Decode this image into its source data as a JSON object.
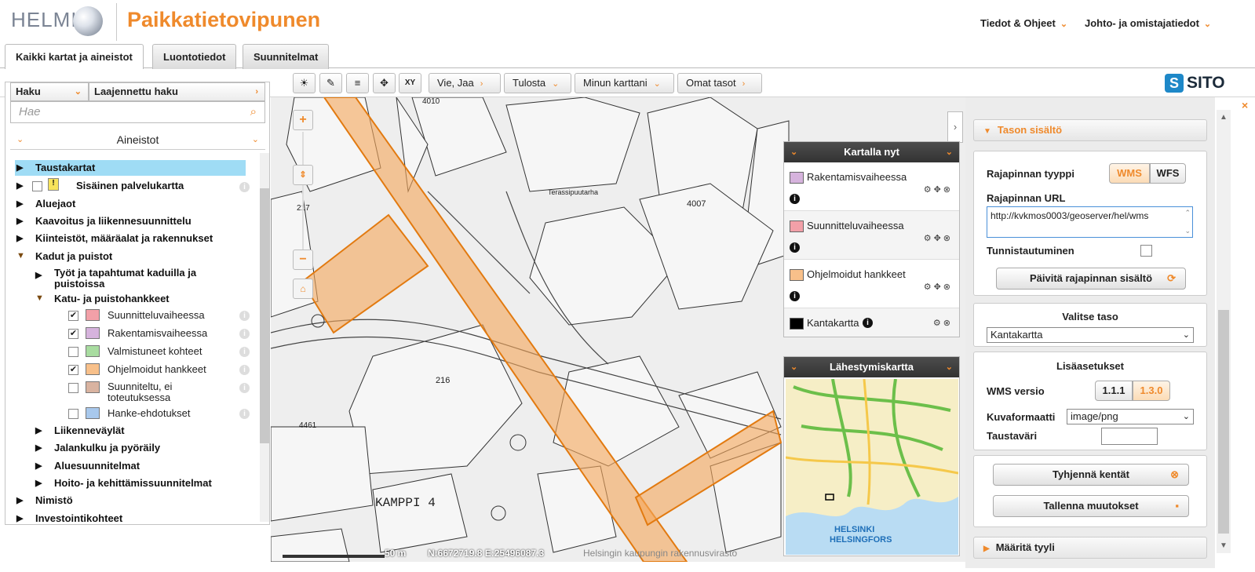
{
  "header": {
    "brand_helmi": "HELMI",
    "app_title": "Paikkatietovipunen",
    "nav": [
      {
        "label": "Tiedot & Ohjeet"
      },
      {
        "label": "Johto- ja omistajatiedot"
      }
    ]
  },
  "tabs": [
    {
      "label": "Kaikki kartat ja aineistot",
      "active": true
    },
    {
      "label": "Luontotiedot",
      "active": false
    },
    {
      "label": "Suunnitelmat",
      "active": false
    }
  ],
  "toolbar": {
    "tool_icons": [
      "sun-icon",
      "ruler-icon",
      "list-icon",
      "move-icon",
      "xy-icon"
    ],
    "xy_label": "XY",
    "dropdowns": [
      {
        "label": "Vie, Jaa"
      },
      {
        "label": "Tulosta"
      },
      {
        "label": "Minun karttani"
      },
      {
        "label": "Omat tasot"
      }
    ],
    "sito_label": "SITO"
  },
  "search": {
    "tab_haku": "Haku",
    "tab_laajennettu": "Laajennettu haku",
    "placeholder": "Hae"
  },
  "aineistot": {
    "title": "Aineistot",
    "tree": {
      "taustakartat": "Taustakartat",
      "sisainen": "Sisäinen palvelukartta",
      "aluejaot": "Aluejaot",
      "kaavoitus": "Kaavoitus ja liikennesuunnittelu",
      "kiinteistot": "Kiinteistöt, määräalat ja rakennukset",
      "kadut": "Kadut ja puistot",
      "tyot_1": "Työt ja tapahtumat kaduilla ja",
      "tyot_2": "puistoissa",
      "katu_hankkeet": "Katu- ja puistohankkeet",
      "layers": [
        {
          "label": "Suunnitteluvaiheessa",
          "checked": true,
          "color": "#f2a0a8"
        },
        {
          "label": "Rakentamisvaiheessa",
          "checked": true,
          "color": "#d6b3dd"
        },
        {
          "label": "Valmistuneet kohteet",
          "checked": false,
          "color": "#a8dca0"
        },
        {
          "label": "Ohjelmoidut hankkeet",
          "checked": true,
          "color": "#f8c08a"
        },
        {
          "label": "Suunniteltu, ei toteutuksessa",
          "checked": false,
          "color": "#d9b3a0"
        },
        {
          "label": "Hanke-ehdotukset",
          "checked": false,
          "color": "#a8c8ec"
        }
      ],
      "suunniteltu_1": "Suunniteltu, ei",
      "suunniteltu_2": "toteutuksessa",
      "liikenne": "Liikenneväylät",
      "jalankulku": "Jalankulku ja pyöräily",
      "alue": "Aluesuunnitelmat",
      "hoito": "Hoito- ja kehittämissuunnitelmat",
      "nimisto": "Nimistö",
      "investointi": "Investointikohteet"
    }
  },
  "map": {
    "labels": {
      "kampin_4": "KAMPPI 4",
      "n216": "216",
      "n4007": "4007",
      "n4010": "4010",
      "n4461": "4461",
      "n217": "217",
      "terassi": "Terassipuutarha"
    },
    "scale": "50 m",
    "coords": "N:6672719.8 E:25496087.3",
    "copyright": "Helsingin kaupungin rakennusvirasto"
  },
  "kartalla_nyt": {
    "title": "Kartalla nyt",
    "layers": [
      {
        "name": "Rakentamisvaiheessa",
        "color": "#d6b3dd"
      },
      {
        "name": "Suunnitteluvaiheessa",
        "color": "#f2a0a8"
      },
      {
        "name": "Ohjelmoidut hankkeet",
        "color": "#f8c08a"
      },
      {
        "name": "Kantakartta",
        "color": "#000000"
      }
    ]
  },
  "lahestymiskartta": {
    "title": "Lähestymiskartta",
    "city_fi": "HELSINKI",
    "city_sv": "HELSINGFORS"
  },
  "right_panel": {
    "tason_sisalto": "Tason sisältö",
    "rajapinnan_tyyppi": "Rajapinnan tyyppi",
    "wms": "WMS",
    "wfs": "WFS",
    "rajapinnan_url_label": "Rajapinnan URL",
    "url_value": "http://kvkmos0003/geoserver/hel/wms",
    "tunnistautuminen": "Tunnistautuminen",
    "paivita": "Päivitä rajapinnan sisältö",
    "valitse_taso": "Valitse taso",
    "taso_value": "Kantakartta",
    "lisaasetukset": "Lisäasetukset",
    "wms_versio": "WMS versio",
    "v111": "1.1.1",
    "v130": "1.3.0",
    "kuvaformaatti": "Kuvaformaatti",
    "kuvaformaatti_value": "image/png",
    "taustavari": "Taustaväri",
    "tyhjenna": "Tyhjennä kentät",
    "tallenna": "Tallenna muutokset",
    "maarita_tyyli": "Määritä tyyli"
  },
  "colors": {
    "accent": "#ef8a2c",
    "highlight": "#9fdcf5",
    "project_area": "#f5a65a"
  }
}
